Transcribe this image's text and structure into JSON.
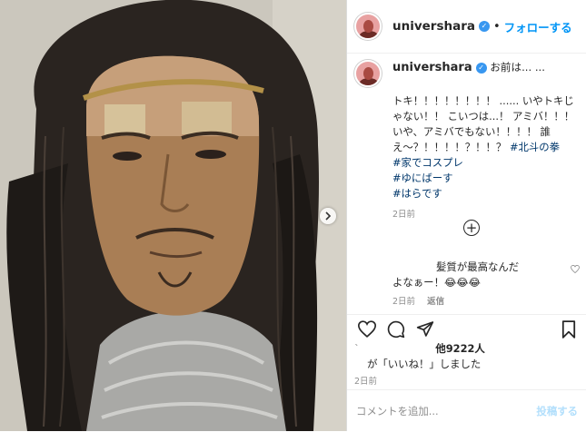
{
  "account": {
    "username": "univershara",
    "follow_label": "フォローする",
    "separator": "•"
  },
  "caption": {
    "lead": "お前は... ...",
    "body": "トキ！！！！！！！！ ...... いやトキじゃない！！ こいつは...！ アミバ！！！ いや、アミバでもない！！！！ 誰え〜？！！！！？！！？",
    "hashtags": [
      "#北斗の拳",
      "#家でコスプレ",
      "#ゆにばーす",
      "#はらです"
    ],
    "time": "2日前"
  },
  "load_more_symbol": "+",
  "comment": {
    "line1": "髪質が最高なんだ",
    "line2": "よなぁー！😂😂😂",
    "time": "2日前",
    "reply_label": "返信"
  },
  "likes": {
    "count": "他9222人",
    "suffix": "が「いいね！」しました",
    "lead": "`"
  },
  "post_time": "2日前",
  "comment_box": {
    "placeholder": "コメントを追加...",
    "post_label": "投稿する"
  },
  "icons": {
    "verified": "verified-badge-icon",
    "heart": "heart-icon",
    "comment": "comment-bubble-icon",
    "share": "paper-plane-icon",
    "bookmark": "bookmark-icon",
    "carousel_next": "chevron-right-icon"
  },
  "colors": {
    "accent": "#0095f6",
    "hashtag": "#00376b",
    "muted": "#8e8e8e"
  }
}
